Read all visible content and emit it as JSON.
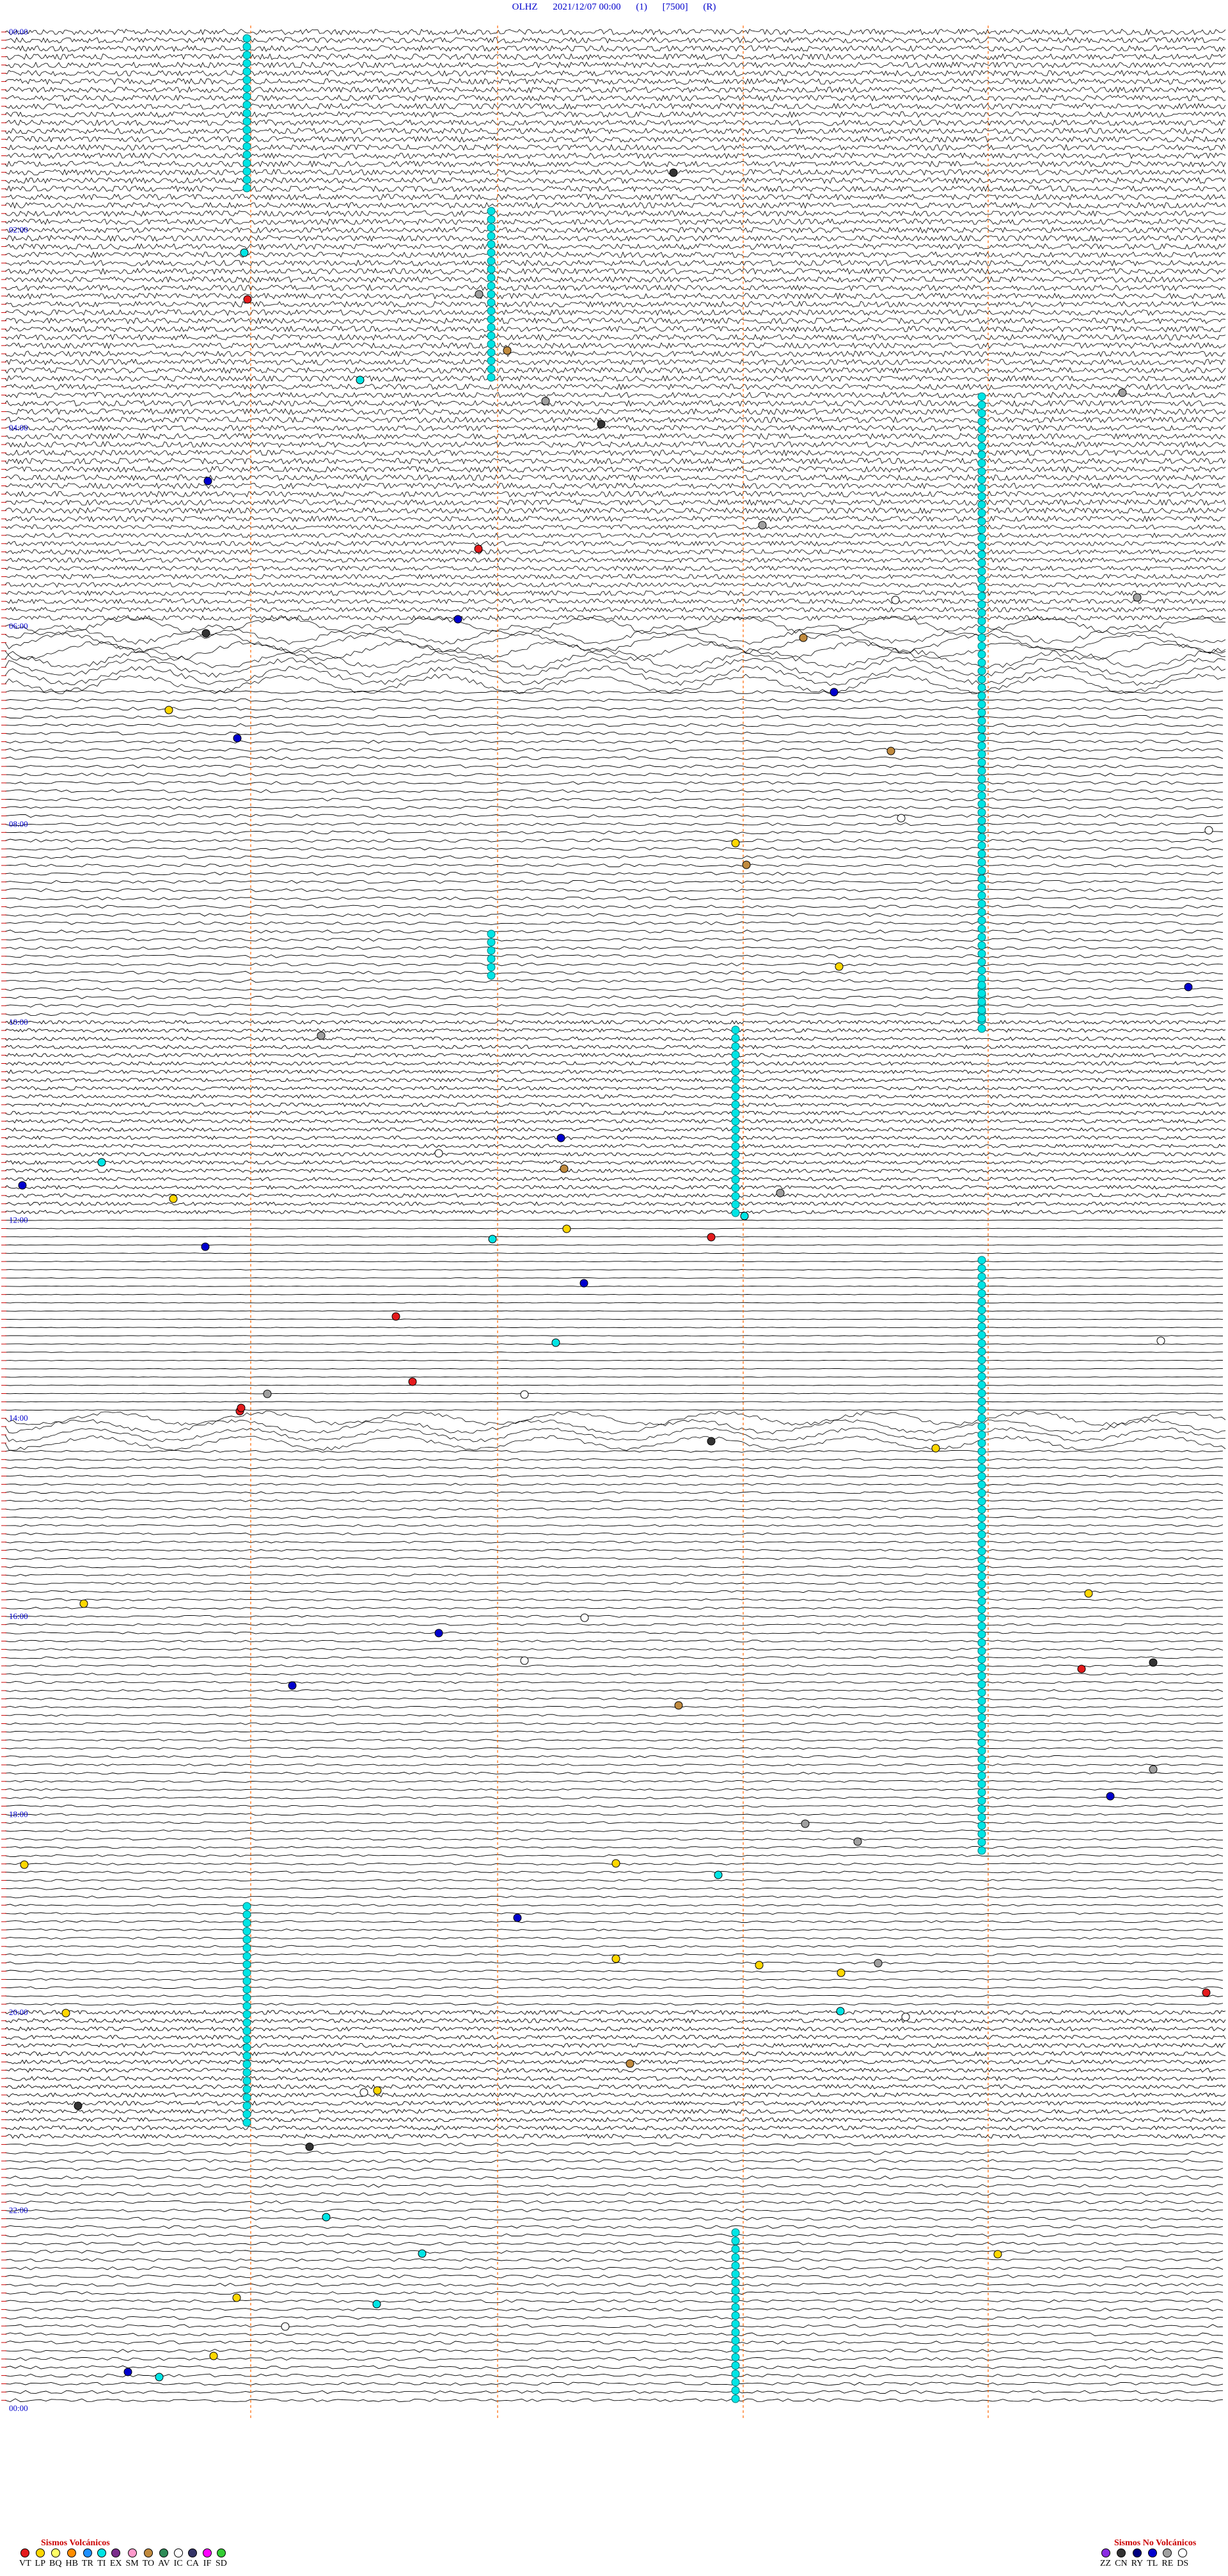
{
  "header": {
    "station": "OLHZ",
    "datetime": "2021/12/07 00:00",
    "channel": "(1)",
    "scale": "[7500]",
    "mode": "(R)"
  },
  "hour_labels": [
    "00:00",
    "02:00",
    "04:00",
    "06:00",
    "08:00",
    "10:00",
    "12:00",
    "14:00",
    "16:00",
    "18:00",
    "20:00",
    "22:00",
    "00:00"
  ],
  "colors": {
    "trace": "#000000",
    "marker_line": "#ff6600",
    "hour_label": "#0000cc",
    "tick": "#cc0000",
    "cyan": "#00e5e5"
  },
  "legend_volcanic": {
    "title": "Sismos Volcánicos",
    "items": [
      {
        "code": "VT",
        "color": "#e41a1c"
      },
      {
        "code": "LP",
        "color": "#ffd700"
      },
      {
        "code": "BQ",
        "color": "#ffff66"
      },
      {
        "code": "HB",
        "color": "#ff8c00"
      },
      {
        "code": "TR",
        "color": "#1e90ff"
      },
      {
        "code": "TI",
        "color": "#00e5e5"
      },
      {
        "code": "EX",
        "color": "#7b2d8b"
      },
      {
        "code": "SM",
        "color": "#ff99cc"
      },
      {
        "code": "TO",
        "color": "#c08a3e"
      },
      {
        "code": "AV",
        "color": "#2e8b57"
      },
      {
        "code": "IC",
        "color": "#ffffff"
      },
      {
        "code": "CA",
        "color": "#333366"
      },
      {
        "code": "IF",
        "color": "#ff00ff"
      },
      {
        "code": "SD",
        "color": "#33cc33"
      }
    ]
  },
  "legend_non_volcanic": {
    "title": "Sismos No Volcánicos",
    "items": [
      {
        "code": "ZZ",
        "color": "#8a2be2"
      },
      {
        "code": "CN",
        "color": "#333333"
      },
      {
        "code": "RY",
        "color": "#000080"
      },
      {
        "code": "TL",
        "color": "#0000cd"
      },
      {
        "code": "RE",
        "color": "#a0a0a0"
      },
      {
        "code": "DS",
        "color": "#ffffff"
      }
    ]
  }
}
